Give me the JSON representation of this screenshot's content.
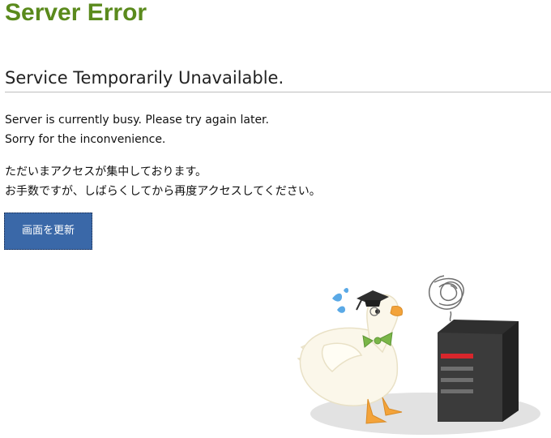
{
  "header": {
    "title": "Server Error",
    "title_color": "#5a8a1c"
  },
  "main": {
    "subtitle": "Service Temporarily Unavailable.",
    "message_en": [
      "Server is currently busy. Please try again later.",
      "Sorry for the inconvenience."
    ],
    "message_ja": [
      "ただいまアクセスが集中しております。",
      "お手数ですが、しばらくしてから再度アクセスしてください。"
    ],
    "refresh_button_label": "画面を更新",
    "button_color": "#3a68a8"
  },
  "illustration": {
    "duck": "duck-with-graduation-cap-icon",
    "server": "server-tower-icon",
    "scribble": "confused-scribble-icon",
    "sweat": "sweat-drops-icon"
  }
}
